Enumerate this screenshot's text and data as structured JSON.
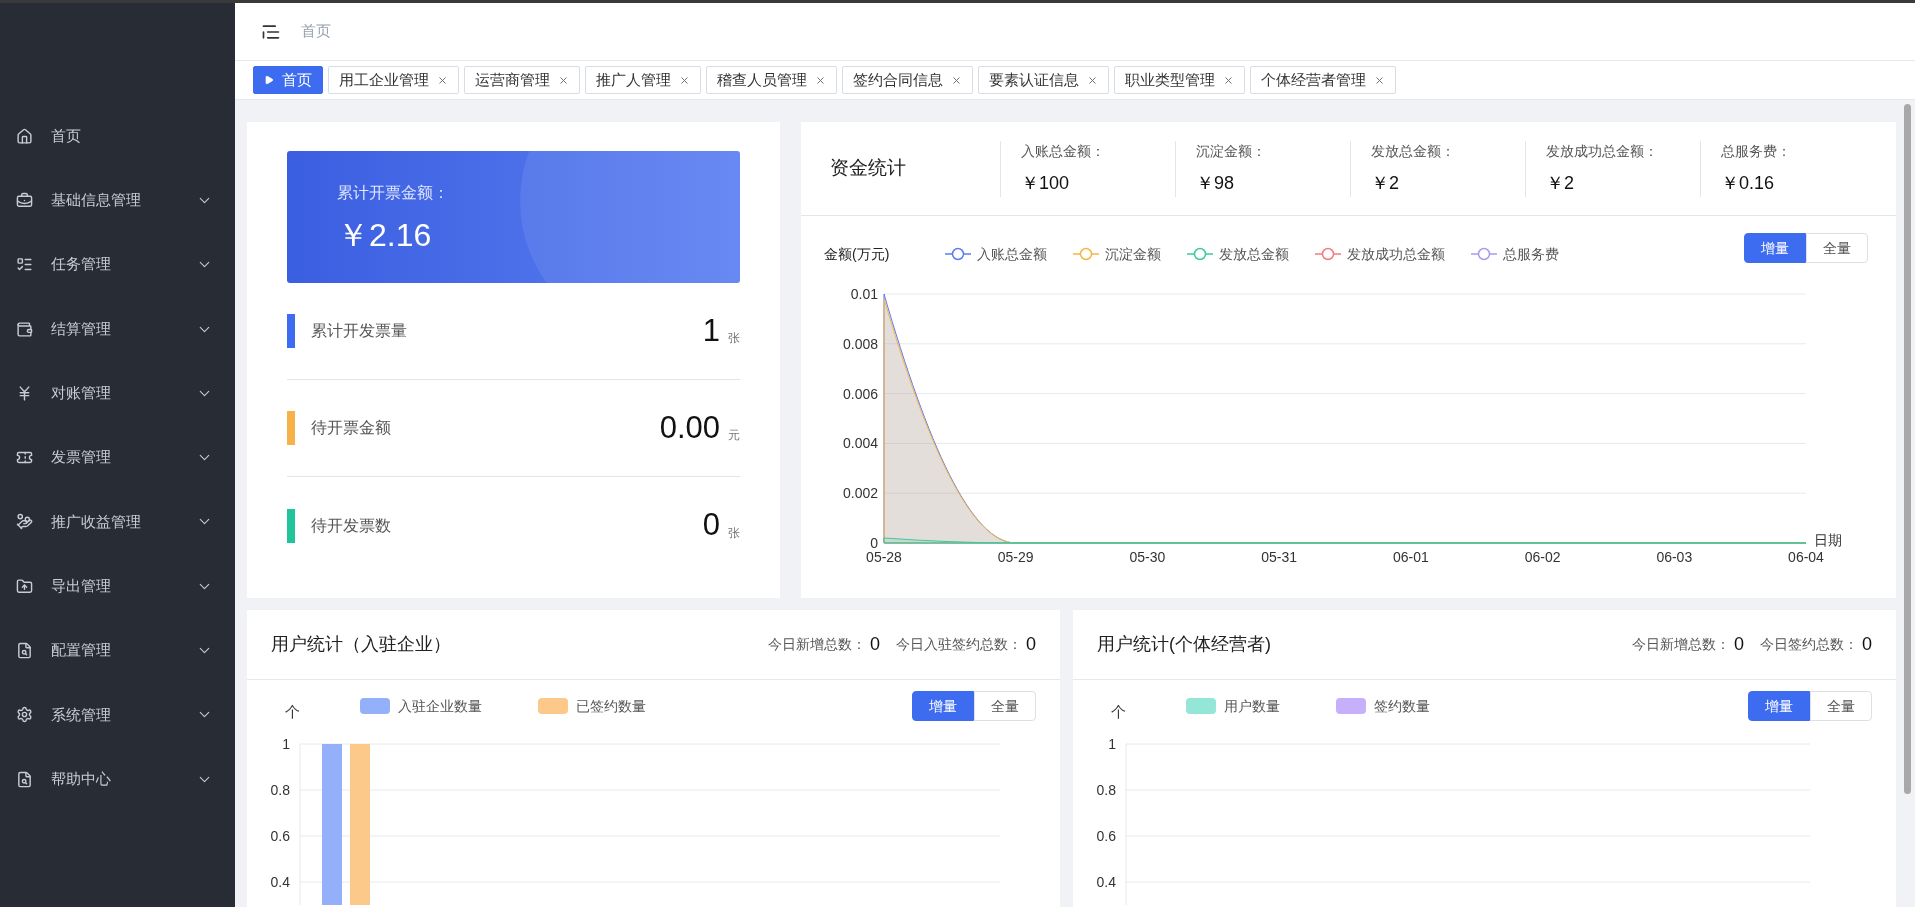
{
  "sidebar": {
    "items": [
      {
        "label": "首页",
        "expandable": false
      },
      {
        "label": "基础信息管理",
        "expandable": true
      },
      {
        "label": "任务管理",
        "expandable": true
      },
      {
        "label": "结算管理",
        "expandable": true
      },
      {
        "label": "对账管理",
        "expandable": true
      },
      {
        "label": "发票管理",
        "expandable": true
      },
      {
        "label": "推广收益管理",
        "expandable": true
      },
      {
        "label": "导出管理",
        "expandable": true
      },
      {
        "label": "配置管理",
        "expandable": true
      },
      {
        "label": "系统管理",
        "expandable": true
      },
      {
        "label": "帮助中心",
        "expandable": true
      }
    ]
  },
  "header": {
    "breadcrumb": "首页"
  },
  "tags": [
    {
      "label": "首页",
      "selected": true,
      "closable": false
    },
    {
      "label": "用工企业管理",
      "selected": false,
      "closable": true
    },
    {
      "label": "运营商管理",
      "selected": false,
      "closable": true
    },
    {
      "label": "推广人管理",
      "selected": false,
      "closable": true
    },
    {
      "label": "稽查人员管理",
      "selected": false,
      "closable": true
    },
    {
      "label": "签约合同信息",
      "selected": false,
      "closable": true
    },
    {
      "label": "要素认证信息",
      "selected": false,
      "closable": true
    },
    {
      "label": "职业类型管理",
      "selected": false,
      "closable": true
    },
    {
      "label": "个体经营者管理",
      "selected": false,
      "closable": true
    }
  ],
  "invoice_card": {
    "banner": {
      "label": "累计开票金额：",
      "value": "￥2.16"
    },
    "stats": [
      {
        "label": "累计开发票量",
        "value": "1",
        "unit": "张",
        "color": "#3e6cf0"
      },
      {
        "label": "待开票金额",
        "value": "0.00",
        "unit": "元",
        "color": "#f7b149"
      },
      {
        "label": "待开发票数",
        "value": "0",
        "unit": "张",
        "color": "#1fc49a"
      }
    ]
  },
  "fund_card": {
    "title": "资金统计",
    "metrics": [
      {
        "label": "入账总金额：",
        "value": "￥100"
      },
      {
        "label": "沉淀金额：",
        "value": "￥98"
      },
      {
        "label": "发放总金额：",
        "value": "￥2"
      },
      {
        "label": "发放成功总金额：",
        "value": "￥2"
      },
      {
        "label": "总服务费：",
        "value": "￥0.16"
      }
    ],
    "toggle": [
      {
        "label": "增量",
        "selected": true
      },
      {
        "label": "全量",
        "selected": false
      }
    ],
    "chart_data": {
      "type": "area",
      "ylabel": "金额(万元)",
      "xlabel": "日期",
      "categories": [
        "05-28",
        "05-29",
        "05-30",
        "05-31",
        "06-01",
        "06-02",
        "06-03",
        "06-04"
      ],
      "yticks": [
        0,
        0.002,
        0.004,
        0.006,
        0.008,
        0.01
      ],
      "ylim": [
        0,
        0.01
      ],
      "grid": true,
      "series": [
        {
          "name": "入账总金额",
          "color": "#5b7bf0",
          "values": [
            0.01,
            0,
            0,
            0,
            0,
            0,
            0,
            0
          ]
        },
        {
          "name": "沉淀金额",
          "color": "#f5b547",
          "values": [
            0.0098,
            0,
            0,
            0,
            0,
            0,
            0,
            0
          ]
        },
        {
          "name": "发放总金额",
          "color": "#3cc9a0",
          "values": [
            0.0002,
            0,
            0,
            0,
            0,
            0,
            0,
            0
          ]
        },
        {
          "name": "发放成功总金额",
          "color": "#f37b7b",
          "values": [
            null,
            null,
            null,
            null,
            null,
            null,
            null,
            null
          ]
        },
        {
          "name": "总服务费",
          "color": "#a99af0",
          "values": [
            null,
            null,
            null,
            null,
            null,
            null,
            null,
            null
          ]
        }
      ]
    }
  },
  "user_cards": [
    {
      "title": "用户统计（入驻企业）",
      "counters": [
        {
          "label": "今日新增总数：",
          "value": "0"
        },
        {
          "label": "今日入驻签约总数：",
          "value": "0"
        }
      ],
      "toggle": [
        {
          "label": "增量",
          "selected": true
        },
        {
          "label": "全量",
          "selected": false
        }
      ],
      "chart_data": {
        "type": "bar",
        "ylabel": "个",
        "yticks": [
          0.4,
          0.6,
          0.8,
          1
        ],
        "ylim": [
          0.3,
          1
        ],
        "grid": true,
        "series": [
          {
            "name": "入驻企业数量",
            "color": "#94b0fb",
            "values": [
              1
            ]
          },
          {
            "name": "已签约数量",
            "color": "#fdc98a",
            "values": [
              1
            ]
          }
        ]
      }
    },
    {
      "title": "用户统计(个体经营者)",
      "counters": [
        {
          "label": "今日新增总数：",
          "value": "0"
        },
        {
          "label": "今日签约总数：",
          "value": "0"
        }
      ],
      "toggle": [
        {
          "label": "增量",
          "selected": true
        },
        {
          "label": "全量",
          "selected": false
        }
      ],
      "chart_data": {
        "type": "bar",
        "ylabel": "个",
        "yticks": [
          0.4,
          0.6,
          0.8,
          1
        ],
        "ylim": [
          0.3,
          1
        ],
        "grid": true,
        "series": [
          {
            "name": "用户数量",
            "color": "#94e6d6",
            "values": [
              null
            ]
          },
          {
            "name": "签约数量",
            "color": "#c6b0fb",
            "values": [
              null
            ]
          }
        ]
      }
    }
  ]
}
